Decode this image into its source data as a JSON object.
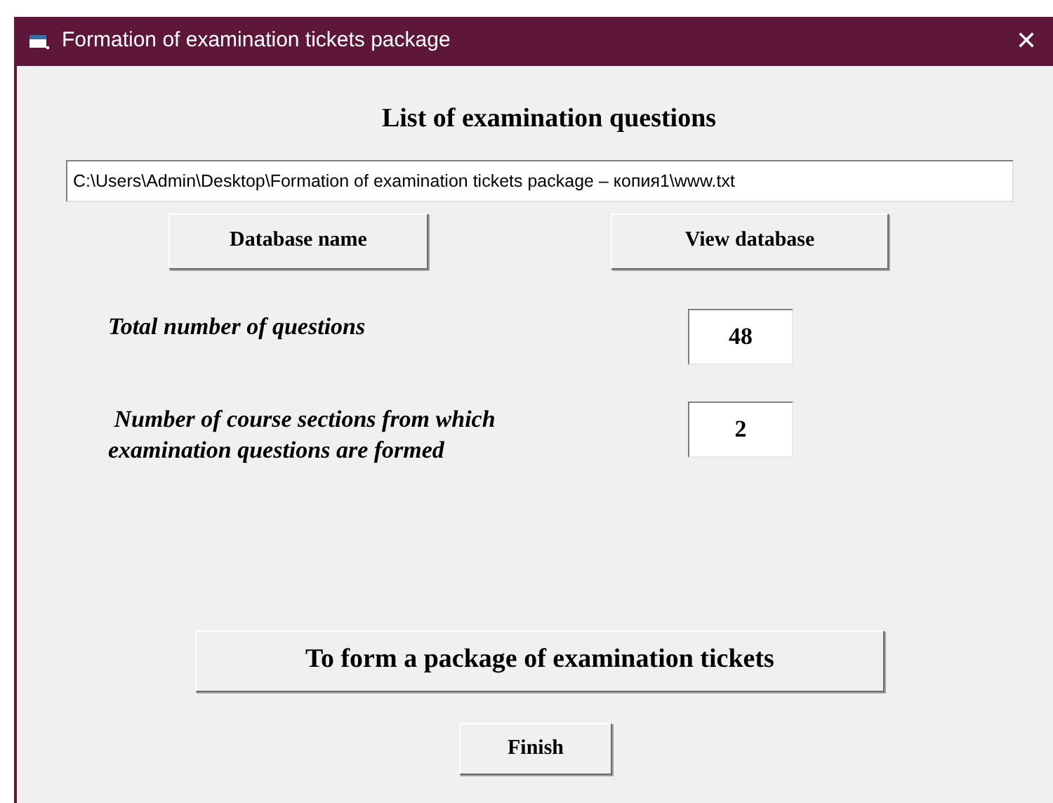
{
  "window": {
    "title": "Formation of examination tickets package",
    "close": "✕"
  },
  "heading": "List of examination questions",
  "path_field": {
    "value": "C:\\Users\\Admin\\Desktop\\Formation of examination tickets package – копия1\\www.txt"
  },
  "top_buttons": [
    "Database name",
    "View database"
  ],
  "stats": [
    {
      "label": "Total number of questions",
      "value": "48"
    },
    {
      "label": " Number of course sections from which examination questions are formed",
      "value": "2"
    }
  ],
  "form_button": "To form a package of examination tickets",
  "finish_button": "Finish"
}
